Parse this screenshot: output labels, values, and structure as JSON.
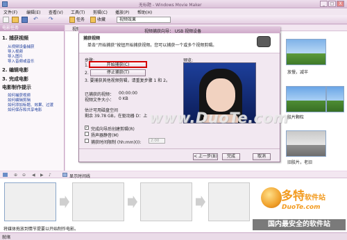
{
  "app": {
    "title": "无标题 - Windows Movie Maker",
    "minimize": "_",
    "maximize": "□",
    "close": "X"
  },
  "menu": [
    "文件(F)",
    "编辑(E)",
    "查看(V)",
    "工具(T)",
    "剪辑(C)",
    "播放(P)",
    "帮助(H)"
  ],
  "toolbar": {
    "tasks": "任务",
    "collections": "收藏",
    "collection_select": "视频效果"
  },
  "tasks_pane": {
    "header": "电影任务",
    "section1": "1. 捕获视频",
    "section1_links": [
      "从视频设备捕获",
      "导入视频",
      "导入图片",
      "导入音频或音乐"
    ],
    "section2": "2. 编辑电影",
    "section3": "3. 完成电影",
    "section4": "电影制作提示",
    "section4_links": [
      "如何捕获视频",
      "如何编辑剪辑",
      "如何添加标题、效果、过渡",
      "如何保存和共享电影"
    ]
  },
  "collection": {
    "header": "视频效果",
    "items": [
      "放慢，减半",
      "胶片颗粒",
      "旧胶片，老旧"
    ]
  },
  "dialog": {
    "title": "视频捕获向导： USB 视频设备",
    "heading": "捕获视频",
    "description": "单击“开始捕获”按钮开始捕获视频。您可以捕获一个或多个视频剪辑。",
    "steps_label": "步骤:",
    "step1_num": "1.",
    "step2_num": "2.",
    "start_capture": "开始捕获(C)",
    "stop_capture": "停止捕获(T)",
    "step3": "3. 要捕获其他视频剪辑，请重复步骤 1 和 2。",
    "captured_label": "已捕获的视频：",
    "captured_value": "00:00:00",
    "filesize_label": "视频文件大小：",
    "filesize_value": "0 KB",
    "disk_label": "估计可用磁盘空间",
    "disk_value": "剩余 39.78 GB，在驱动器 D：上",
    "create_clips": "完成向导后创建剪辑(R)",
    "mute": "扬声器静音(M)",
    "time_limit": "捕获时间限制 (hh:mm)(I):",
    "time_limit_value": "2:00",
    "preview_label": "预览:",
    "back": "< 上一步(B)",
    "finish": "完成",
    "cancel": "取消"
  },
  "timeline": {
    "show_label": "显示时间线"
  },
  "status": {
    "hint": "将媒体拖放到情节提要以开始制作电影。",
    "ready": "就绪"
  },
  "watermarks": {
    "top": "www.DuoTe.com",
    "brand": "多特",
    "brand_suffix": "软件站",
    "brand_url": "DuoTe.com",
    "tag": "国内最安全的软件站"
  },
  "colors": {
    "chrome": "#e9d6e7",
    "accent": "#c79fc2",
    "link": "#1d3d9c",
    "highlight_border": "#d40000"
  }
}
